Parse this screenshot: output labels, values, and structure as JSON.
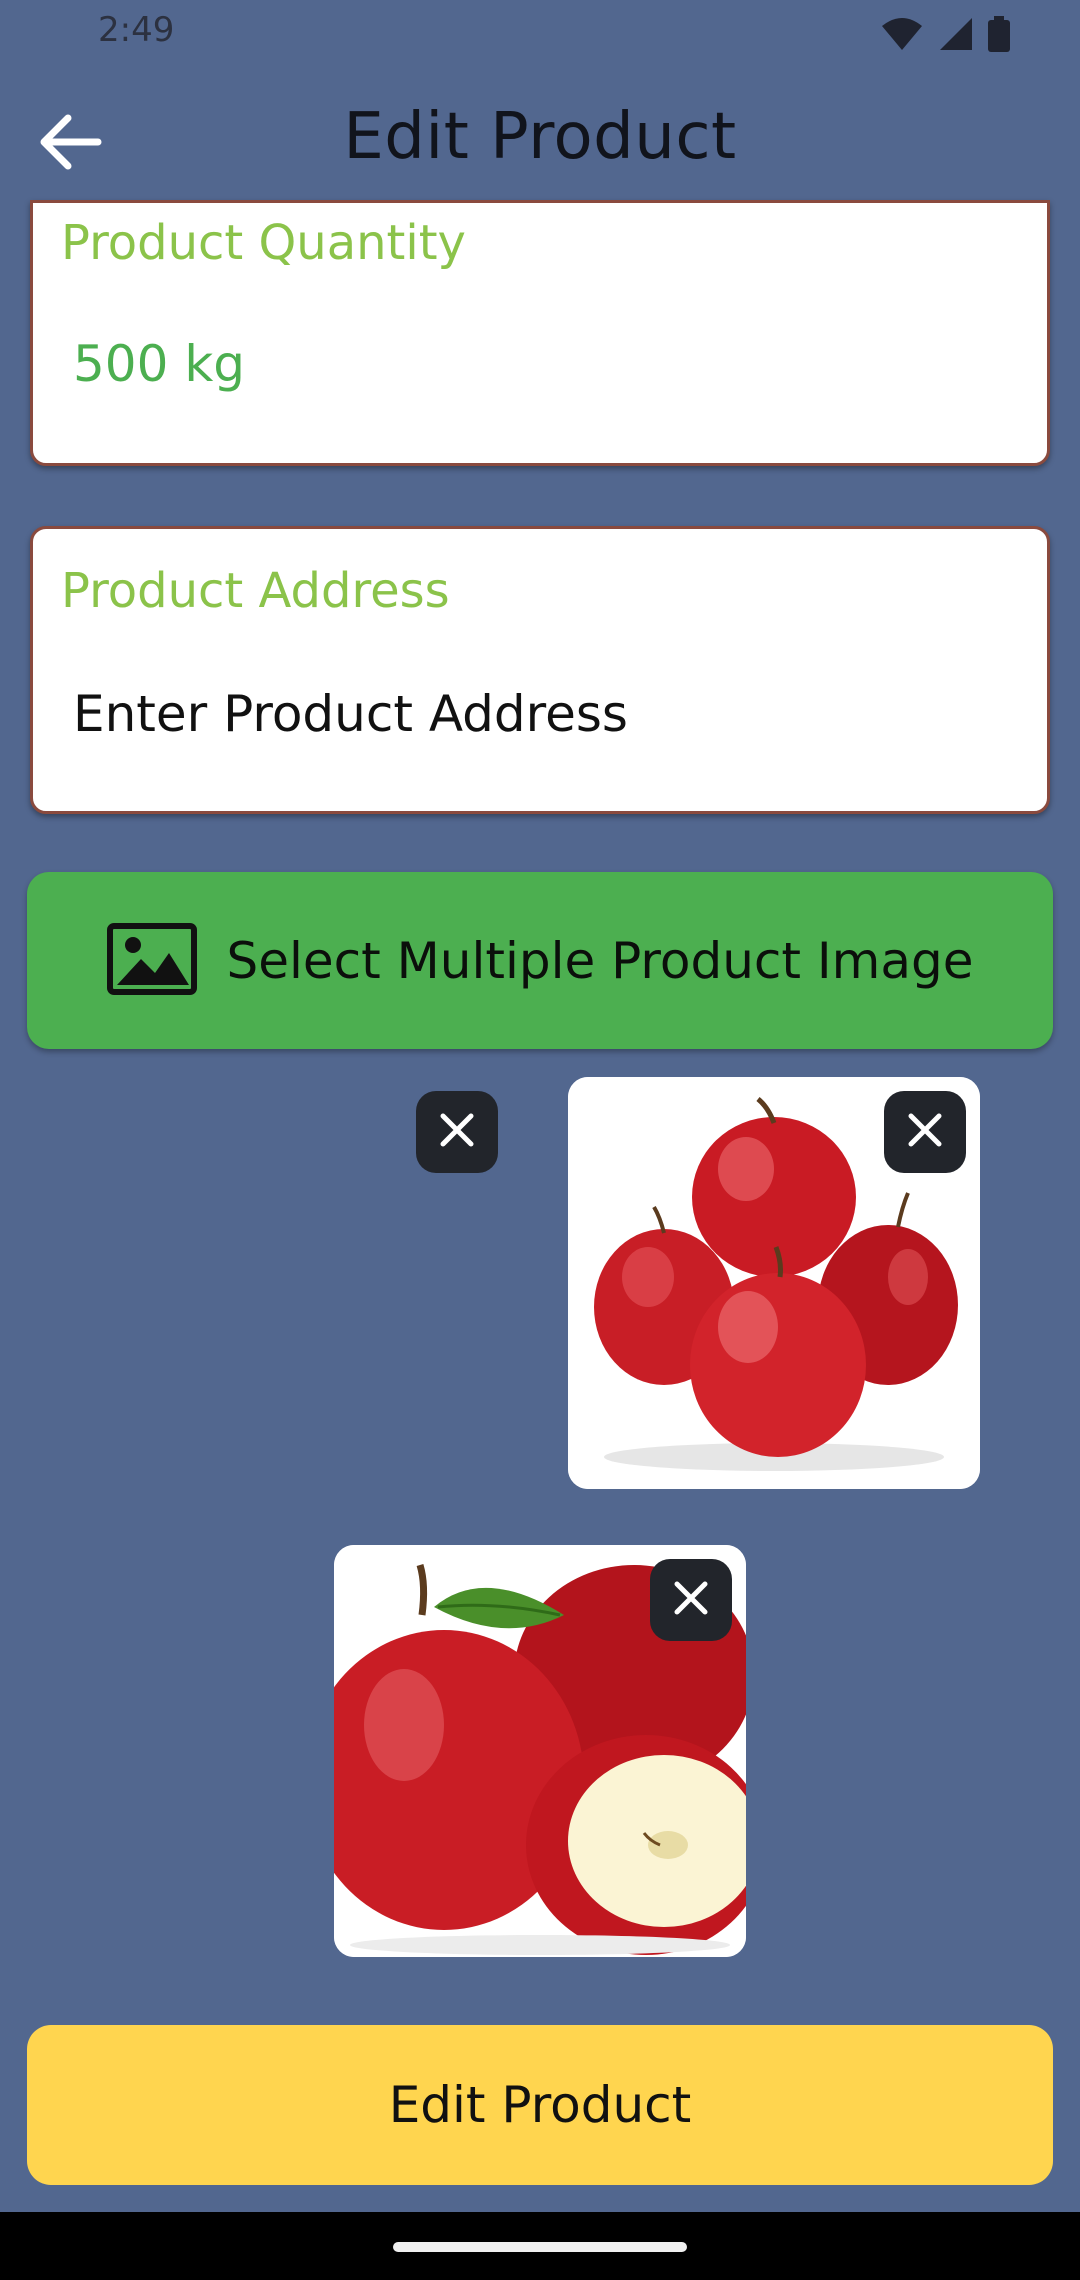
{
  "status_bar": {
    "time": "2:49",
    "icons": [
      "wifi-icon",
      "signal-icon",
      "battery-icon"
    ]
  },
  "app_bar": {
    "title": "Edit Product",
    "back_icon": "arrow-left-icon"
  },
  "form": {
    "quantity": {
      "label": "Product Quantity",
      "value": "500 kg"
    },
    "address": {
      "label": "Product Address",
      "placeholder": "Enter Product Address"
    }
  },
  "select_images_button": {
    "label": "Select Multiple Product Image",
    "icon": "image-icon"
  },
  "images": [
    {
      "name": "empty-image",
      "close_icon": "close-icon"
    },
    {
      "name": "apples-pile-image",
      "close_icon": "close-icon"
    },
    {
      "name": "apples-sliced-image",
      "close_icon": "close-icon"
    }
  ],
  "edit_button": {
    "label": "Edit Product"
  },
  "colors": {
    "background": "#52678f",
    "label_green": "#8bc34a",
    "value_green": "#4caf50",
    "select_button": "#4caf50",
    "edit_button": "#ffd54f",
    "card_border": "#8a4a3e"
  }
}
